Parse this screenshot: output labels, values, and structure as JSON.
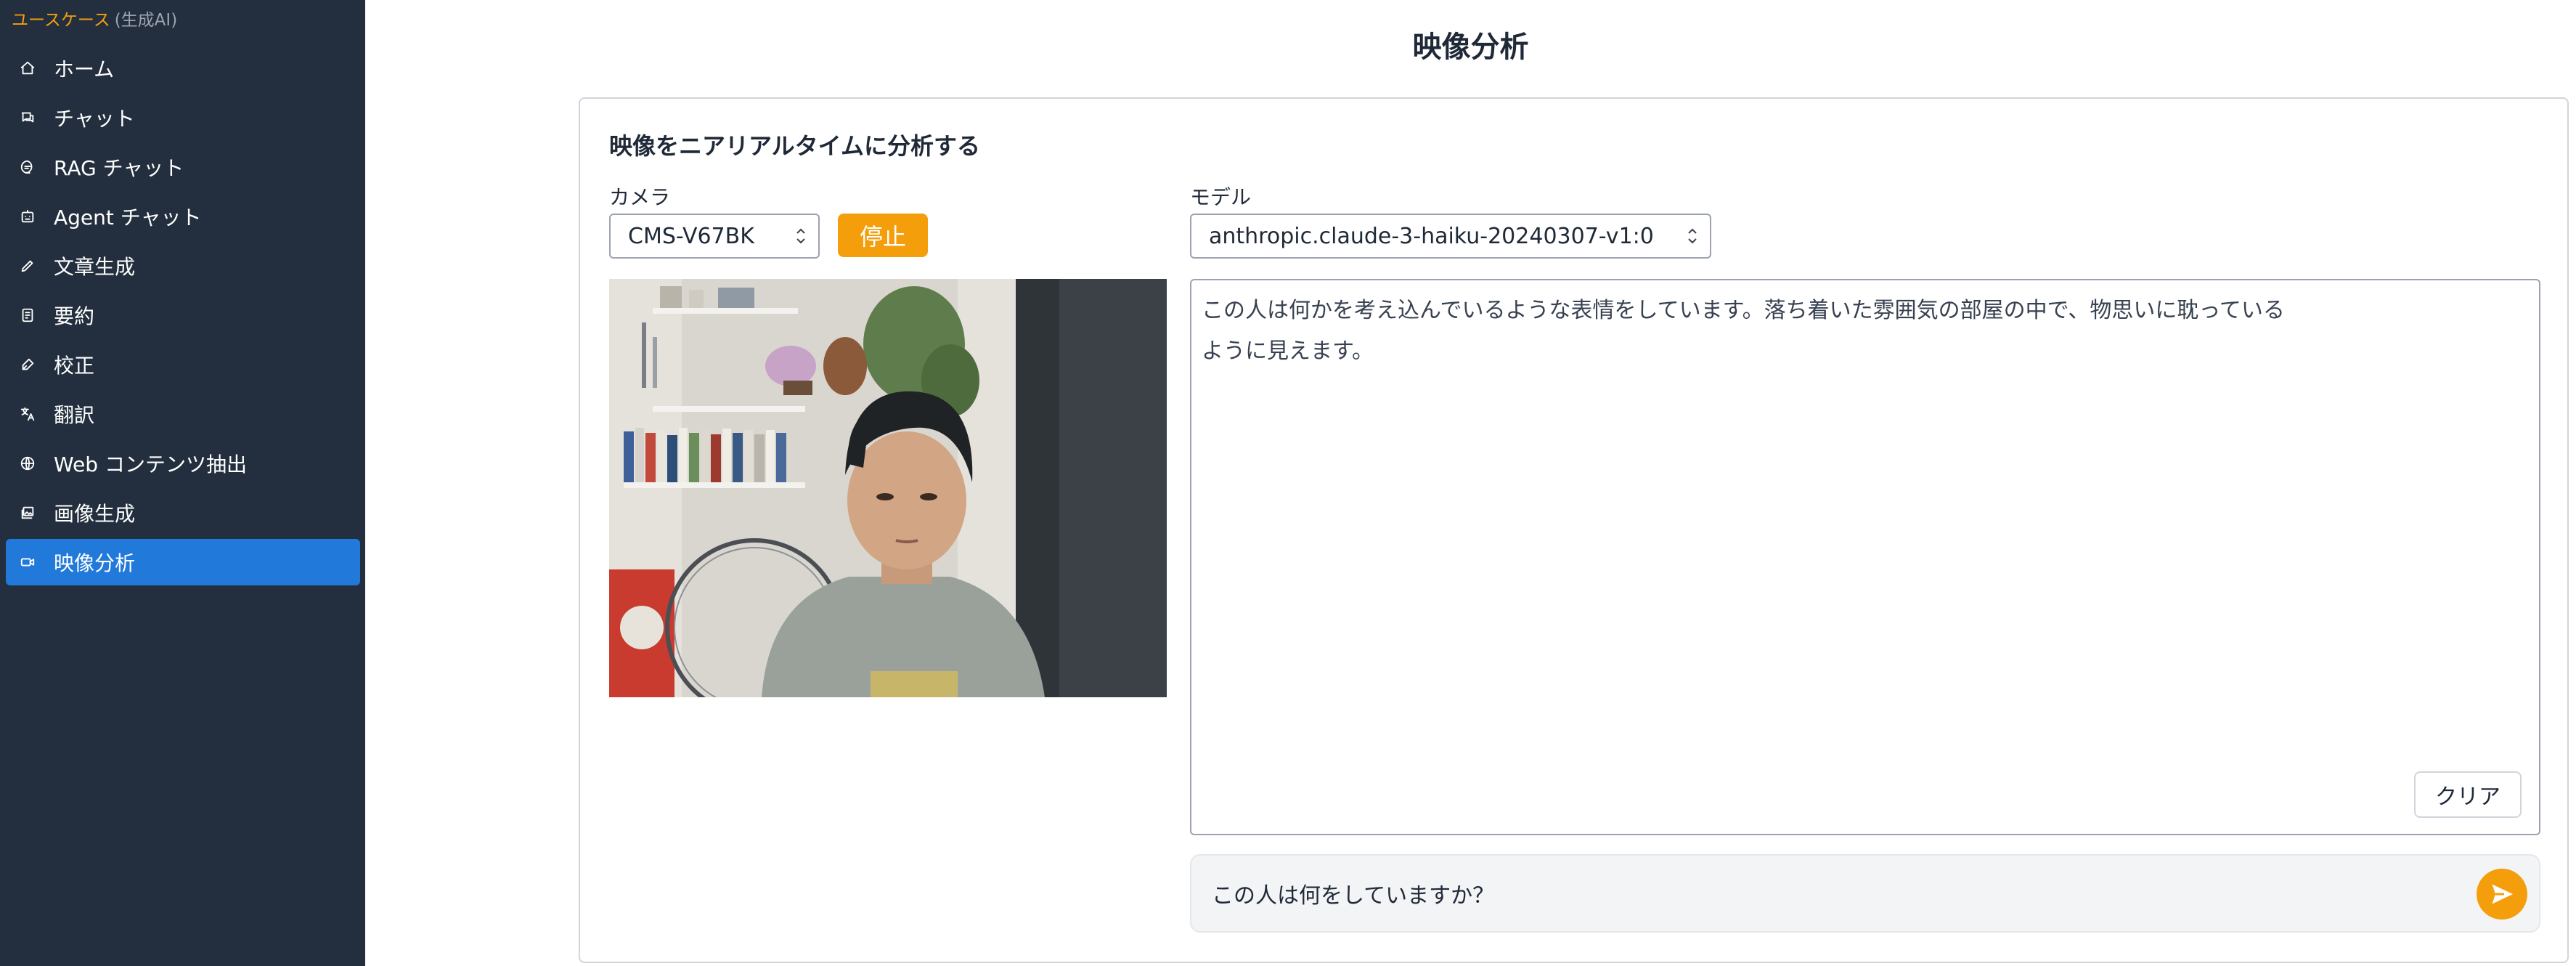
{
  "sidebar": {
    "header": {
      "accent": "ユースケース",
      "muted": "(生成AI)"
    },
    "items": [
      {
        "label": "ホーム",
        "icon": "home-icon"
      },
      {
        "label": "チャット",
        "icon": "chat-icon"
      },
      {
        "label": "RAG チャット",
        "icon": "rag-chat-icon"
      },
      {
        "label": "Agent チャット",
        "icon": "agent-icon"
      },
      {
        "label": "文章生成",
        "icon": "pencil-icon"
      },
      {
        "label": "要約",
        "icon": "summary-icon"
      },
      {
        "label": "校正",
        "icon": "proofread-icon"
      },
      {
        "label": "翻訳",
        "icon": "translate-icon"
      },
      {
        "label": "Web コンテンツ抽出",
        "icon": "globe-icon"
      },
      {
        "label": "画像生成",
        "icon": "image-icon"
      },
      {
        "label": "映像分析",
        "icon": "video-icon",
        "active": true
      }
    ]
  },
  "page": {
    "title": "映像分析"
  },
  "card": {
    "title": "映像をニアリアルタイムに分析する",
    "camera": {
      "label": "カメラ",
      "selected": "CMS-V67BK"
    },
    "stop_label": "停止",
    "model": {
      "label": "モデル",
      "selected": "anthropic.claude-3-haiku-20240307-v1:0"
    },
    "output_text": "この人は何かを考え込んでいるような表情をしています。落ち着いた雰囲気の部屋の中で、物思いに耽っているように見えます。",
    "clear_label": "クリア",
    "input": {
      "value": "この人は何をしていますか？"
    }
  },
  "colors": {
    "sidebar_bg": "#232f3e",
    "active": "#2179d9",
    "accent": "#f59e0b"
  }
}
